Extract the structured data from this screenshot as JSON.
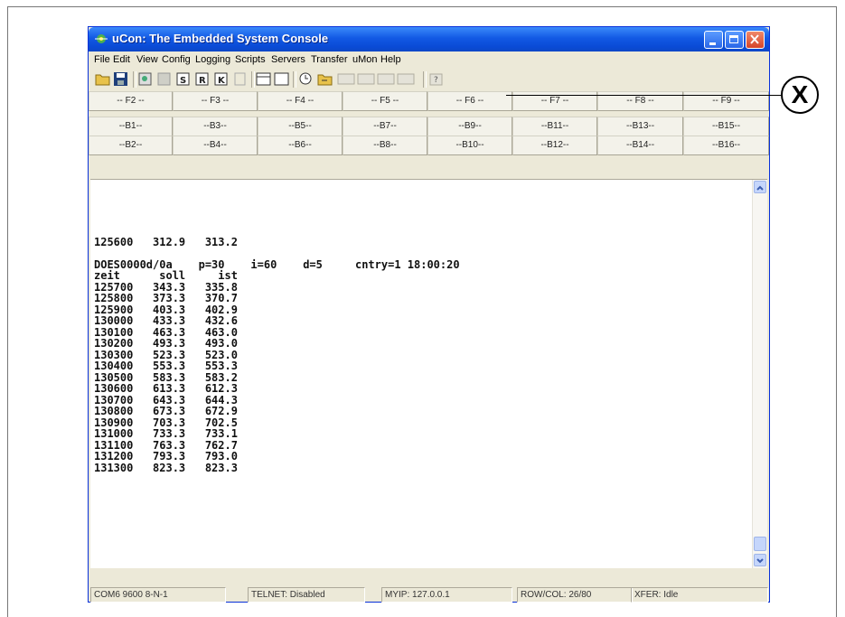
{
  "window": {
    "title": "uCon: The Embedded System Console"
  },
  "menu": [
    "File",
    "Edit",
    "View",
    "Config",
    "Logging",
    "Scripts",
    "Servers",
    "Transfer",
    "uMon",
    "Help"
  ],
  "fkeys": [
    "-- F2 --",
    "-- F3 --",
    "-- F4 --",
    "-- F5 --",
    "-- F6 --",
    "-- F7 --",
    "-- F8 --",
    "-- F9 --"
  ],
  "bkeys_row1": [
    "--B1--",
    "--B3--",
    "--B5--",
    "--B7--",
    "--B9--",
    "--B11--",
    "--B13--",
    "--B15--"
  ],
  "bkeys_row2": [
    "--B2--",
    "--B4--",
    "--B6--",
    "--B8--",
    "--B10--",
    "--B12--",
    "--B14--",
    "--B16--"
  ],
  "console_lines": [
    "",
    "",
    "",
    "",
    "",
    "125600   312.9   313.2",
    "",
    "DOES0000d/0a    p=30    i=60    d=5     cntry=1 18:00:20",
    "zeit      soll     ist",
    "125700   343.3   335.8",
    "125800   373.3   370.7",
    "125900   403.3   402.9",
    "130000   433.3   432.6",
    "130100   463.3   463.0",
    "130200   493.3   493.0",
    "130300   523.3   523.0",
    "130400   553.3   553.3",
    "130500   583.3   583.2",
    "130600   613.3   612.3",
    "130700   643.3   644.3",
    "130800   673.3   672.9",
    "130900   703.3   702.5",
    "131000   733.3   733.1",
    "131100   763.3   762.7",
    "131200   793.3   793.0",
    "131300   823.3   823.3"
  ],
  "status": {
    "port": "COM6 9600 8-N-1",
    "telnet": "TELNET: Disabled",
    "myip": "MYIP: 127.0.0.1",
    "rowcol": "ROW/COL: 26/80",
    "xfer": "XFER: Idle"
  },
  "callout": "X"
}
